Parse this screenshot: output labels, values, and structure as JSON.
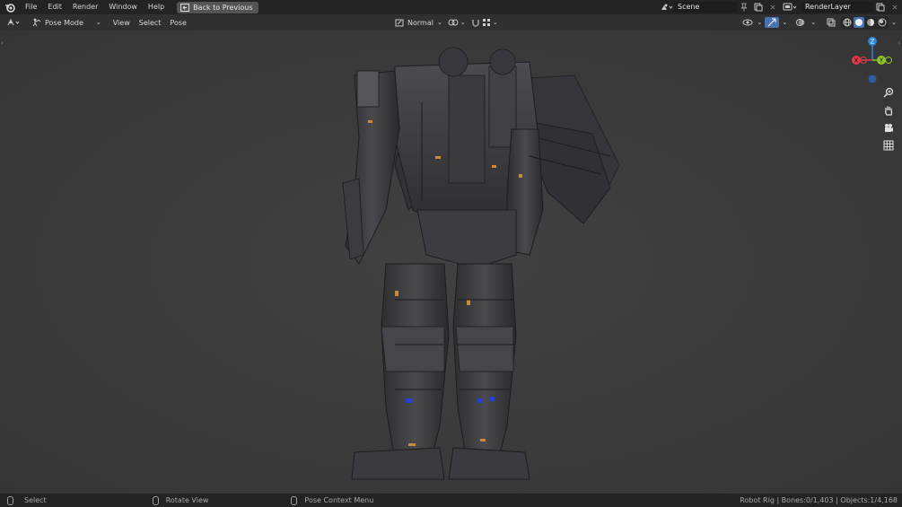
{
  "topbar": {
    "menu": [
      "File",
      "Edit",
      "Render",
      "Window",
      "Help"
    ],
    "back_button": "Back to Previous",
    "scene": "Scene",
    "render_layer": "RenderLayer"
  },
  "header": {
    "mode": "Pose Mode",
    "menus": [
      "View",
      "Select",
      "Pose"
    ],
    "orientation": "Normal"
  },
  "gizmo": {
    "z_label": "Z",
    "y_label": "Y",
    "x_label": "X",
    "colors": {
      "x": "#e2394d",
      "y": "#8bc425",
      "z": "#2f83e2"
    }
  },
  "statusbar": {
    "select": "Select",
    "rotate": "Rotate View",
    "context": "Pose Context Menu",
    "stats": "Robot Rig | Bones:0/1,403 | Objects:1/4,168"
  },
  "theme": {
    "accent": "#4772b3",
    "orange_detail": "#c98a3d",
    "blue_joint": "#2a3fd0"
  }
}
